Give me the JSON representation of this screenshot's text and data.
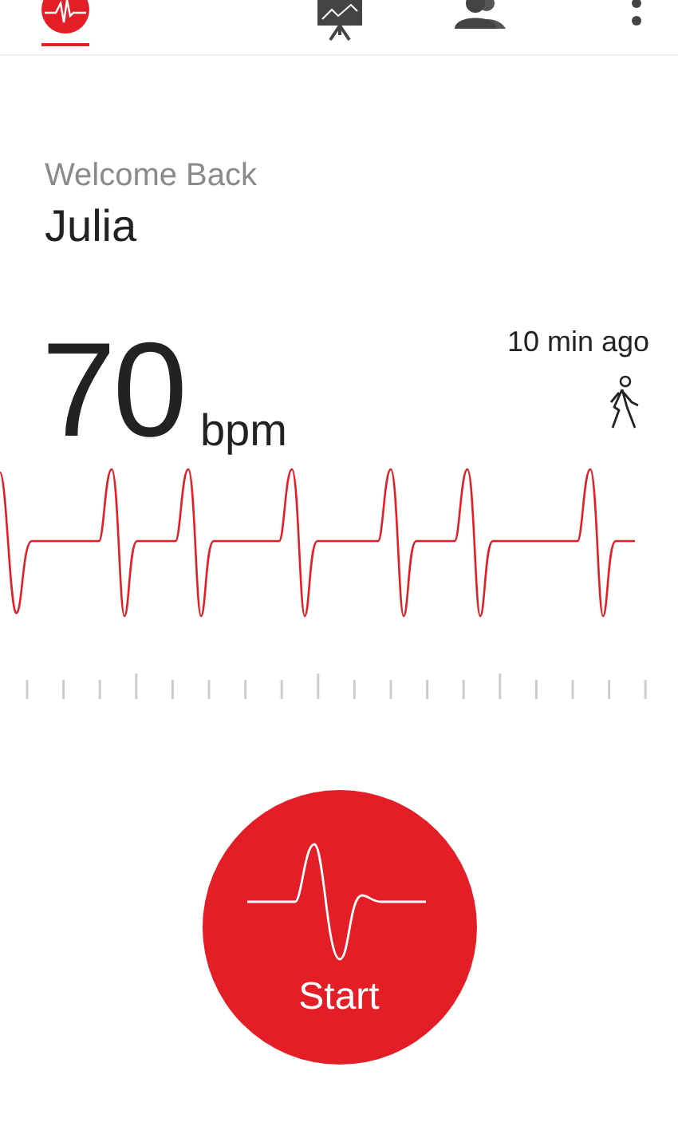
{
  "tabs": [
    {
      "kind": "heart",
      "selected": true
    },
    {
      "kind": "chart",
      "selected": false
    },
    {
      "kind": "people",
      "selected": false
    }
  ],
  "greeting": "Welcome Back",
  "user_name": "Julia",
  "heart_rate": {
    "value": "70",
    "unit": "bpm",
    "time": "10 min ago"
  },
  "start_button": {
    "label": "Start"
  }
}
